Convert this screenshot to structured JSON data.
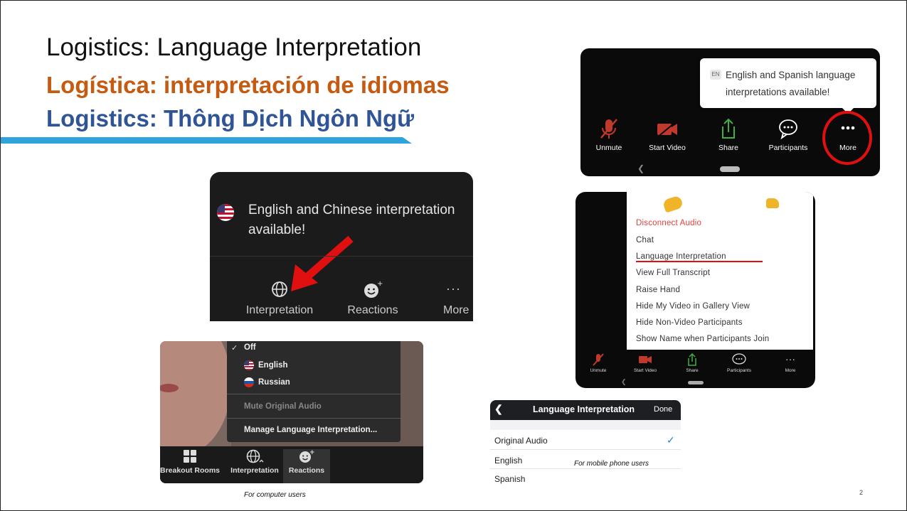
{
  "titles": {
    "english": "Logistics: Language Interpretation",
    "spanish": "Logística: interpretación de idiomas",
    "vietnamese": "Logistics: Thông Dịch Ngôn Ngữ"
  },
  "mobile_toolbar": {
    "lang_badge": "EN",
    "tooltip": "English and Spanish language interpretations available!",
    "buttons": [
      "Unmute",
      "Start Video",
      "Share",
      "Participants",
      "More"
    ]
  },
  "desktop_tooltip": {
    "tooltip": "English and Chinese interpretation available!",
    "buttons": [
      "Interpretation",
      "Reactions",
      "More"
    ]
  },
  "desktop_dropdown": {
    "menu": {
      "off": "Off",
      "languages": [
        "English",
        "Russian"
      ],
      "mute_original": "Mute Original Audio",
      "manage": "Manage Language Interpretation..."
    },
    "toolbar": [
      "Breakout Rooms",
      "Interpretation",
      "Reactions"
    ],
    "caption": "For computer users"
  },
  "mobile_more_menu": {
    "items": [
      "Disconnect Audio",
      "Chat",
      "Language Interpretation",
      "View Full Transcript",
      "Raise Hand",
      "Hide My Video in Gallery View",
      "Hide Non-Video Participants",
      "Show Name when Participants Join"
    ],
    "buttons": [
      "Unmute",
      "Start Video",
      "Share",
      "Participants",
      "More"
    ]
  },
  "mobile_interpretation": {
    "title": "Language Interpretation",
    "done": "Done",
    "rows": [
      "Original Audio",
      "English",
      "Spanish"
    ],
    "caption": "For mobile phone users"
  },
  "page_number": "2",
  "colors": {
    "spanish_title": "#c55a11",
    "vietnamese_title": "#2f5597",
    "accent_line": "#2ea3dc",
    "highlight_red": "#e01010"
  }
}
